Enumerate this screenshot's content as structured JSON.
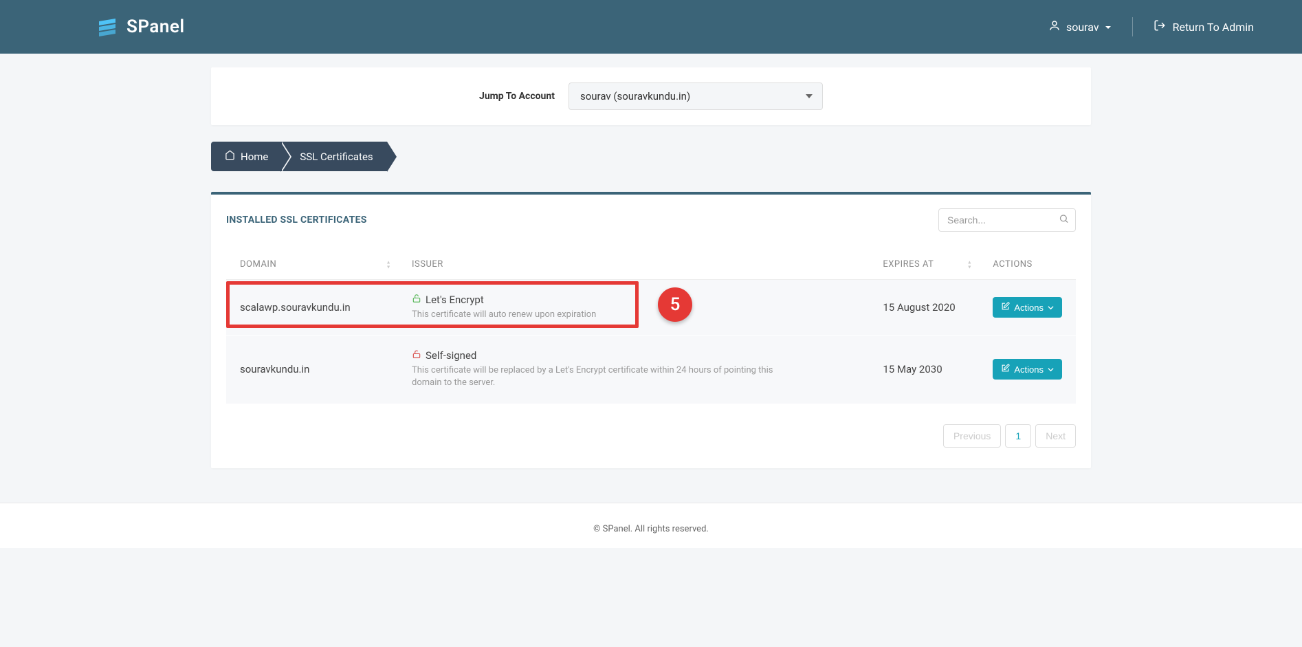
{
  "header": {
    "brand": "SPanel",
    "username": "sourav",
    "return_link": "Return To Admin"
  },
  "jump": {
    "label": "Jump To Account",
    "selected": "sourav (souravkundu.in)"
  },
  "breadcrumb": {
    "home": "Home",
    "current": "SSL Certificates"
  },
  "card": {
    "title": "INSTALLED SSL CERTIFICATES",
    "search_placeholder": "Search..."
  },
  "columns": {
    "domain": "DOMAIN",
    "issuer": "ISSUER",
    "expires": "EXPIRES AT",
    "actions": "ACTIONS"
  },
  "rows": [
    {
      "domain": "scalawp.souravkundu.in",
      "issuer": "Let's Encrypt",
      "issuer_note": "This certificate will auto renew upon expiration",
      "lock": "green",
      "expires": "15 August 2020",
      "action_label": "Actions"
    },
    {
      "domain": "souravkundu.in",
      "issuer": "Self-signed",
      "issuer_note": "This certificate will be replaced by a Let's Encrypt certificate within 24 hours of pointing this domain to the server.",
      "lock": "red",
      "expires": "15 May 2030",
      "action_label": "Actions"
    }
  ],
  "annotation": {
    "step": "5"
  },
  "pagination": {
    "prev": "Previous",
    "page": "1",
    "next": "Next"
  },
  "footer": "© SPanel. All rights reserved."
}
